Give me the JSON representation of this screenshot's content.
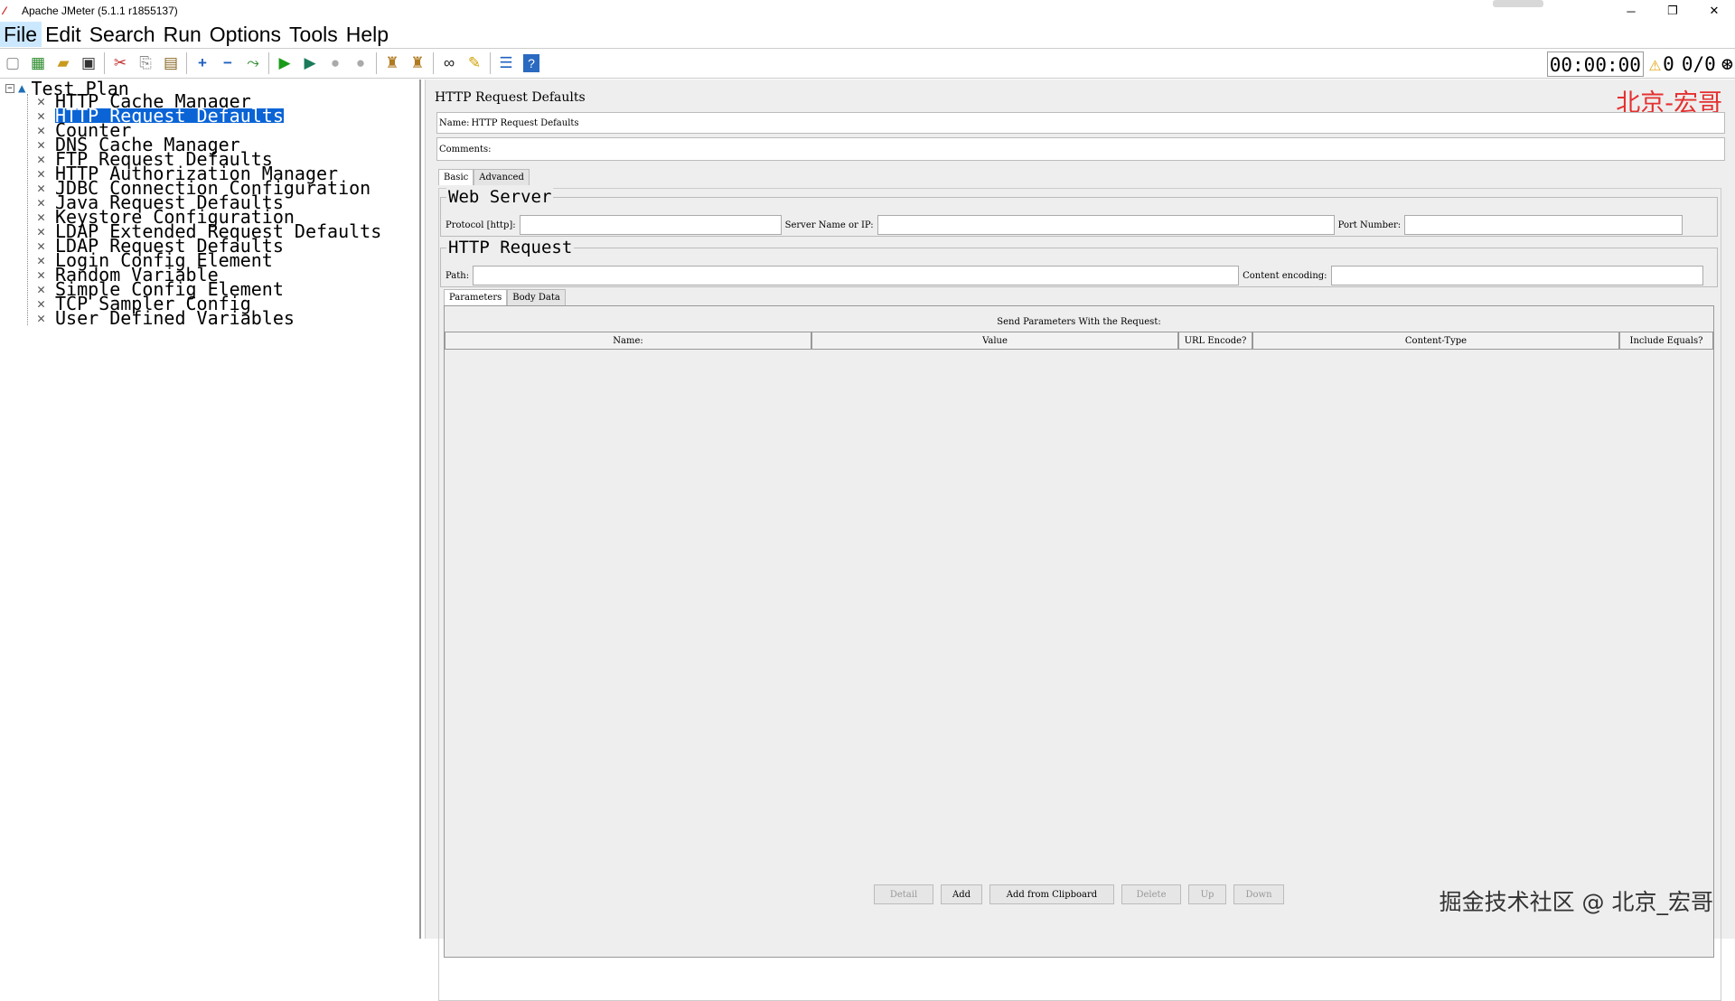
{
  "window": {
    "title": "Apache JMeter (5.1.1 r1855137)",
    "app_icon": "feather-icon",
    "controls": {
      "minimize": "─",
      "restore": "❐",
      "close": "✕"
    }
  },
  "menu": [
    "File",
    "Edit",
    "Search",
    "Run",
    "Options",
    "Tools",
    "Help"
  ],
  "toolbar": {
    "buttons": [
      {
        "name": "new-icon",
        "glyph": "🗋"
      },
      {
        "name": "templates-icon",
        "glyph": "▦"
      },
      {
        "name": "open-icon",
        "glyph": "📂"
      },
      {
        "name": "save-icon",
        "glyph": "💾"
      },
      {
        "name": "cut-icon",
        "glyph": "✂"
      },
      {
        "name": "copy-icon",
        "glyph": "⎘"
      },
      {
        "name": "paste-icon",
        "glyph": "📋"
      },
      {
        "name": "expand-icon",
        "glyph": "+"
      },
      {
        "name": "collapse-icon",
        "glyph": "−"
      },
      {
        "name": "toggle-icon",
        "glyph": "⤳"
      },
      {
        "name": "start-icon",
        "glyph": "▶"
      },
      {
        "name": "start-no-pause-icon",
        "glyph": "▶"
      },
      {
        "name": "stop-icon",
        "glyph": "●"
      },
      {
        "name": "shutdown-icon",
        "glyph": "●"
      },
      {
        "name": "clear-icon",
        "glyph": "🧹"
      },
      {
        "name": "clear-all-icon",
        "glyph": "🧹"
      },
      {
        "name": "search-icon",
        "glyph": "👓"
      },
      {
        "name": "reset-search-icon",
        "glyph": "🧽"
      },
      {
        "name": "function-helper-icon",
        "glyph": "☰"
      },
      {
        "name": "help-icon",
        "glyph": "?"
      }
    ],
    "timer": "00:00:00",
    "warnings": "0",
    "threads": "0/0"
  },
  "tree": {
    "root": "Test Plan",
    "items": [
      "HTTP Cache Manager",
      "HTTP Request Defaults",
      "Counter",
      "DNS Cache Manager",
      "FTP Request Defaults",
      "HTTP Authorization Manager",
      "JDBC Connection Configuration",
      "Java Request Defaults",
      "Keystore Configuration",
      "LDAP Extended Request Defaults",
      "LDAP Request Defaults",
      "Login Config Element",
      "Random Variable",
      "Simple Config Element",
      "TCP Sampler Config",
      "User Defined Variables"
    ],
    "selected_index": 1
  },
  "panel": {
    "title": "HTTP Request Defaults",
    "watermark_top": "北京-宏哥",
    "name_label": "Name:",
    "name_value": "HTTP Request Defaults",
    "comments_label": "Comments:",
    "comments_value": "",
    "tabs": [
      "Basic",
      "Advanced"
    ],
    "web_server": {
      "title": "Web Server",
      "protocol_label": "Protocol [http]:",
      "protocol_value": "",
      "server_label": "Server Name or IP:",
      "server_value": "",
      "port_label": "Port Number:",
      "port_value": ""
    },
    "http_request": {
      "title": "HTTP Request",
      "path_label": "Path:",
      "path_value": "",
      "encoding_label": "Content encoding:",
      "encoding_value": ""
    },
    "sub_tabs": [
      "Parameters",
      "Body Data"
    ],
    "params_table": {
      "caption": "Send Parameters With the Request:",
      "columns": [
        "Name:",
        "Value",
        "URL Encode?",
        "Content-Type",
        "Include Equals?"
      ],
      "rows": []
    },
    "buttons": [
      {
        "label": "Detail",
        "enabled": false
      },
      {
        "label": "Add",
        "enabled": true
      },
      {
        "label": "Add from Clipboard",
        "enabled": true
      },
      {
        "label": "Delete",
        "enabled": false
      },
      {
        "label": "Up",
        "enabled": false
      },
      {
        "label": "Down",
        "enabled": false
      }
    ],
    "watermark_bottom": "掘金技术社区 @ 北京_宏哥"
  }
}
